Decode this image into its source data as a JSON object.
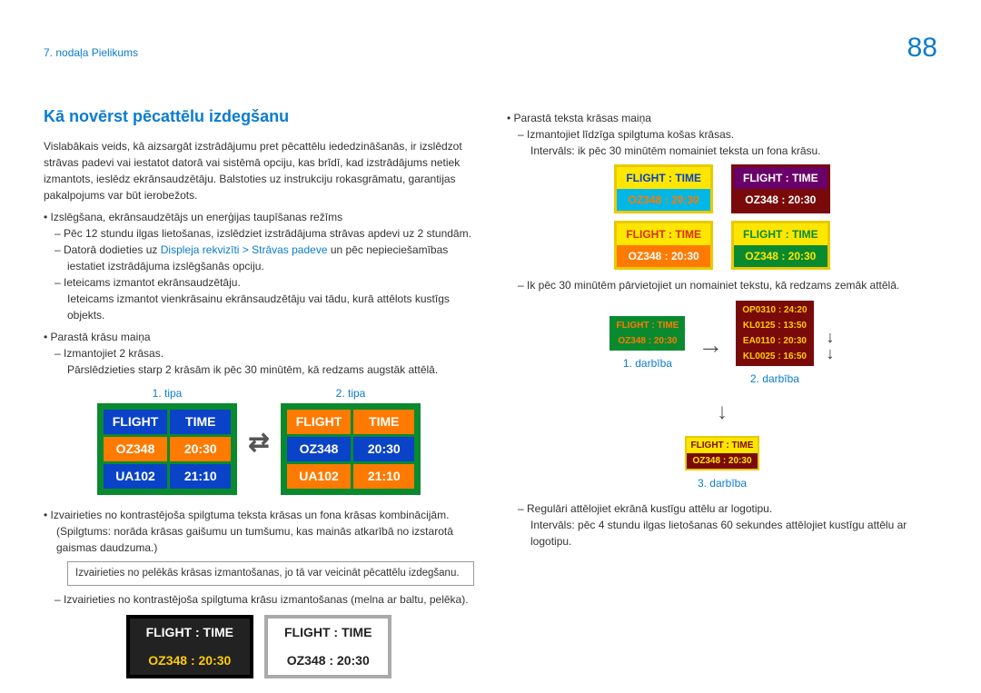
{
  "chapter": "7. nodaļa Pielikums",
  "pageNumber": "88",
  "h2": "Kā novērst pēcattēlu izdegšanu",
  "intro": "Vislabākais veids, kā aizsargāt izstrādājumu pret pēcattēlu iededzināšanās, ir izslēdzot strāvas padevi vai iestatot datorā vai sistēmā opciju, kas brīdī, kad izstrādājums netiek izmantots, ieslēdz ekrānsaudzētāju. Balstoties uz instrukciju rokasgrāmatu, garantijas pakalpojums var būt ierobežots.",
  "b1": "Izslēgšana, ekrānsaudzētājs un enerģijas taupīšanas režīms",
  "b1d1": "Pēc 12 stundu ilgas lietošanas, izslēdziet izstrādājuma strāvas apdevi uz 2 stundām.",
  "b1d2a": "Datorā dodieties uz ",
  "b1d2link": "Displeja rekvizīti > Strāvas padeve",
  "b1d2b": " un pēc nepieciešamības iestatiet izstrādājuma izslēgšanās opciju.",
  "b1d3": "Ieteicams izmantot ekrānsaudzētāju.",
  "b1d3s": "Ieteicams izmantot vienkrāsainu ekrānsaudzētāju vai tādu, kurā attēlots kustīgs objekts.",
  "b2": "Parastā krāsu maiņa",
  "b2d1": "Izmantojiet 2 krāsas.",
  "b2d1s": "Pārslēdzieties starp 2 krāsām ik pēc 30 minūtēm, kā redzams augstāk attēlā.",
  "type1": "1. tipa",
  "type2": "2. tipa",
  "labelFlight": "FLIGHT",
  "labelTime": "TIME",
  "row_oz_n": "OZ348",
  "row_oz_t": "20:30",
  "row_ua_n": "UA102",
  "row_ua_t": "21:10",
  "b3": "Izvairieties no kontrastējoša spilgtuma teksta krāsas un fona krāsas kombinācijām.",
  "b3p": "(Spilgtums: norāda krāsas gaišumu un tumšumu, kas mainās atkarībā no izstarotā gaismas daudzuma.)",
  "note": "Izvairieties no pelēkās krāsas izmantošanas, jo tā var veicināt pēcattēlu izdegšanu.",
  "b4d": "Izvairieties no kontrastējoša spilgtuma krāsu izmantošanas (melna ar baltu, pelēka).",
  "flightColonTime": "FLIGHT   :   TIME",
  "ozColonT": "OZ348   :   20:30",
  "r_b1": "Parastā teksta krāsas maiņa",
  "r_b1d1": "Izmantojiet līdzīga spilgtuma košas krāsas.",
  "r_b1d1s": "Intervāls: ik pēc 30 minūtēm nomainiet teksta un fona krāsu.",
  "r_b2d": "Ik pēc 30 minūtēm pārvietojiet un nomainiet tekstu, kā redzams zemāk attēlā.",
  "step1": "1. darbība",
  "step2": "2. darbība",
  "step3": "3. darbība",
  "s2r1n": "OP0310",
  "s2r1t": "24:20",
  "s2r2n": "KL0125",
  "s2r2t": "13:50",
  "s2r3n": "EA0110",
  "s2r3t": "20:30",
  "s2r4n": "KL0025",
  "s2r4t": "16:50",
  "r_b3d": "Regulāri attēlojiet ekrānā kustīgu attēlu ar logotipu.",
  "r_b3ds": "Intervāls: pēc 4 stundu ilgas lietošanas 60 sekundes attēlojiet kustīgu attēlu ar logotipu."
}
